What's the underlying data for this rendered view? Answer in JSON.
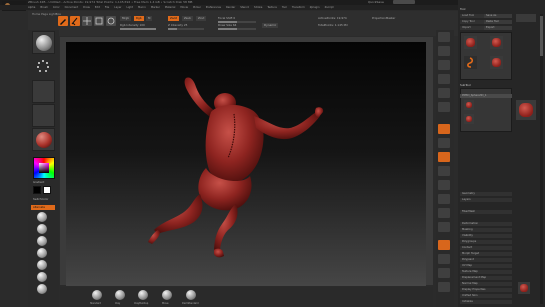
{
  "app": {
    "title_line": "ZBrush 4R5 - Untitled - Active Points: 19,974  Total Points: 1,145,592  •  Free Mem 1.4 GB  •  Scratch Disk 58 MB",
    "quicksave": "QuickSave"
  },
  "menu": [
    "Alpha",
    "Brush",
    "Color",
    "Document",
    "Draw",
    "Edit",
    "File",
    "Layer",
    "Light",
    "Macro",
    "Marker",
    "Material",
    "Movie",
    "Picker",
    "Preferences",
    "Render",
    "Stencil",
    "Stroke",
    "Texture",
    "Tool",
    "Transform",
    "Zplugin",
    "Zscript"
  ],
  "toolbar": {
    "shelf_label": "Home Page   LightBox",
    "edit_label": "Edit",
    "draw_label": "Draw",
    "move_label": "Move",
    "scale_label": "Scale",
    "rotate_label": "Rotate",
    "mrgb_label": "Mrgb",
    "rgb_label": "Rgb",
    "m_label": "M",
    "zadd_label": "Zadd",
    "zsub_label": "Zsub",
    "zcut_label": "Zcut",
    "rgb_intensity_label": "Rgb Intensity 100",
    "z_intensity_label": "Z Intensity 25",
    "focal_shift_label": "Focal Shift 0",
    "draw_size_label": "Draw Size 64",
    "dynamic_label": "Dynamic",
    "active_points_label": "ActivePoints: 19,974",
    "total_points_label": "TotalPoints: 1.145 Mil",
    "projection_label": "ProjectionMaster",
    "slider_rgb_intensity": 1.0,
    "slider_z_intensity": 0.25,
    "slider_draw_size": 0.5
  },
  "left_panel": {
    "gradient_label": "Gradient",
    "switch_color_label": "SwitchColor",
    "alternate_label": "Alternate",
    "primary_color": "#ffffff",
    "secondary_color": "#000000"
  },
  "bottom_bar": {
    "items": [
      "Standard",
      "Clay",
      "ClayBuildup",
      "Move",
      "DamStandard",
      "hPolish"
    ]
  },
  "right_panel": {
    "header": "Tool",
    "load_tool": "Load Tool",
    "save_as": "Save As",
    "copy_tool": "Copy Tool",
    "paste_tool": "Paste Tool",
    "import": "Import",
    "export": "Export",
    "goz": "GoZ",
    "all": "All",
    "visible": "Visible",
    "r": "R",
    "lightbox_tools": "Lightbox▸Tools",
    "tool_name": "PM3D_Sphere3D_1",
    "subtool": "SubTool",
    "geometry": "Geometry",
    "layers": "Layers",
    "fibermesh": "FiberMesh",
    "deformation": "Deformation",
    "masking": "Masking",
    "visibility": "Visibility",
    "polygroups": "Polygroups",
    "contact": "Contact",
    "morph_target": "Morph Target",
    "polypaint": "Polypaint",
    "uv_map": "UV Map",
    "texture_map": "Texture Map",
    "displacement_map": "Displacement Map",
    "normal_map": "Normal Map",
    "display_properties": "Display Properties",
    "unified_skin": "Unified Skin",
    "initialize": "Initialize",
    "import_label": "Import",
    "export_label": "Export"
  },
  "right_tools": [
    "BPR",
    "SPix 3",
    "Scroll",
    "Zoom",
    "Actual",
    "AAHalf",
    "Persp",
    "Floor",
    "Local",
    "L.Sym",
    "Frame",
    "Move",
    "Scale",
    "Rotate",
    "Line Fill",
    "PolyF",
    "Transp",
    "Ghost",
    "Solo",
    "Xpose"
  ],
  "colors": {
    "accent": "#e06a1a",
    "model": "#8e2420"
  }
}
